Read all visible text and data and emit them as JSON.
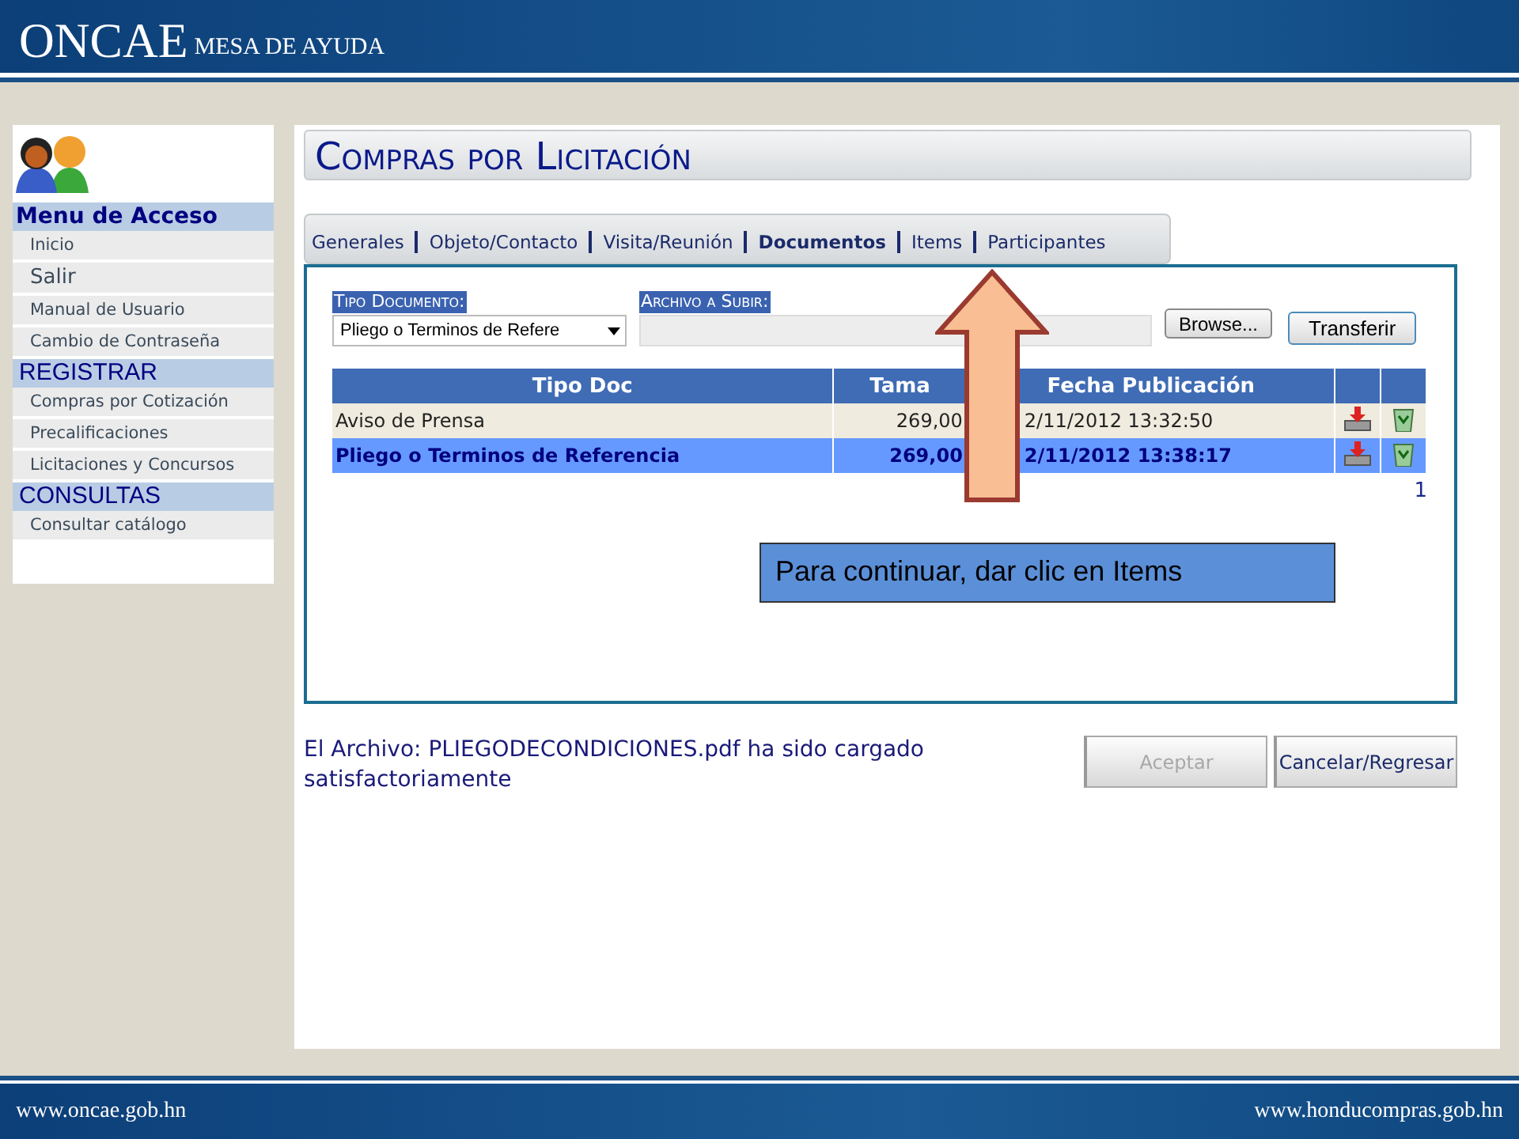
{
  "header": {
    "logo": "ONCAE",
    "subtitle": "MESA DE AYUDA"
  },
  "sidebar": {
    "sections": [
      {
        "heading": "Menu de Acceso",
        "kind": "bold",
        "items": [
          {
            "label": "Inicio",
            "kind": "normal"
          },
          {
            "label": "Salir",
            "kind": "large"
          },
          {
            "label": "Manual de Usuario",
            "kind": "normal"
          },
          {
            "label": "Cambio de Contraseña",
            "kind": "normal"
          }
        ]
      },
      {
        "heading": "REGISTRAR",
        "kind": "plain",
        "items": [
          {
            "label": "Compras por Cotización",
            "kind": "normal"
          },
          {
            "label": "Precalificaciones",
            "kind": "normal"
          },
          {
            "label": "Licitaciones y Concursos",
            "kind": "normal"
          }
        ]
      },
      {
        "heading": "CONSULTAS",
        "kind": "plain",
        "items": [
          {
            "label": "Consultar catálogo",
            "kind": "normal"
          }
        ]
      }
    ]
  },
  "page_title": "Compras por Licitación",
  "tabs": [
    {
      "label": "Generales",
      "selected": false
    },
    {
      "label": "Objeto/Contacto",
      "selected": false
    },
    {
      "label": "Visita/Reunión",
      "selected": false
    },
    {
      "label": "Documentos",
      "selected": true
    },
    {
      "label": "Items",
      "selected": false
    },
    {
      "label": "Participantes",
      "selected": false
    }
  ],
  "form": {
    "doc_type_label": "Tipo Documento:",
    "doc_type_value": "Pliego o Terminos de Refere",
    "file_label": "Archivo a Subir:",
    "browse_button": "Browse...",
    "transfer_button": "Transferir"
  },
  "table": {
    "columns": [
      "Tipo Doc",
      "Tama",
      "Fecha Publicación"
    ],
    "rows": [
      {
        "cells": [
          "Aviso de Prensa",
          "269,00",
          "2/11/2012 13:32:50"
        ],
        "selected": false
      },
      {
        "cells": [
          "Pliego o Terminos de Referencia",
          "269,00",
          "2/11/2012 13:38:17"
        ],
        "selected": true
      }
    ],
    "pager": "1"
  },
  "callout": "Para continuar, dar clic en Items",
  "message": "El Archivo: PLIEGODECONDICIONES.pdf ha sido cargado satisfactoriamente",
  "buttons": [
    {
      "label": "Aceptar",
      "disabled": true
    },
    {
      "label": "Cancelar/Regresar",
      "disabled": false
    }
  ],
  "footer": {
    "left": "www.oncae.gob.hn",
    "right": "www.honducompras.gob.hn"
  }
}
